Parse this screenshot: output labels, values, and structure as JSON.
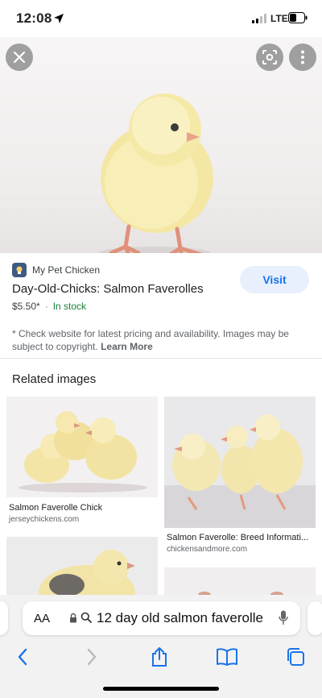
{
  "status_bar": {
    "time": "12:08",
    "network": "LTE"
  },
  "hero": {
    "alt_icons": [
      "close-icon",
      "lens-icon",
      "more-icon"
    ]
  },
  "result": {
    "source": "My Pet Chicken",
    "title": "Day-Old-Chicks: Salmon Faverolles",
    "price": "$5.50*",
    "separator": "·",
    "stock": "In stock",
    "visit_label": "Visit",
    "disclaimer": "* Check website for latest pricing and availability. Images may be subject to copyright.",
    "learn_more": "Learn More"
  },
  "related": {
    "heading": "Related images",
    "items": [
      {
        "title": "Salmon Faverolle Chick",
        "source": "jerseychickens.com"
      },
      {
        "title": "Salmon Faverolle: Breed Informati...",
        "source": "chickensandmore.com"
      }
    ]
  },
  "address_bar": {
    "aa": "AA",
    "text": "12 day old salmon faverolle"
  },
  "colors": {
    "accent": "#1a73e8",
    "stock_green": "#188038",
    "visit_bg": "#e8f0fe"
  }
}
